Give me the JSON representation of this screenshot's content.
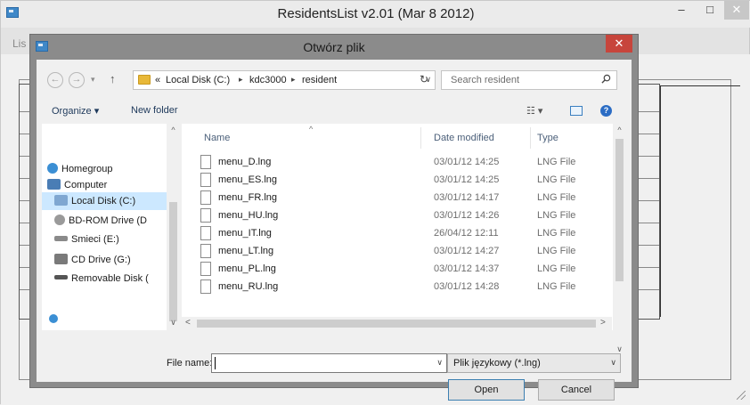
{
  "main_window": {
    "title": "ResidentsList v2.01  (Mar  8 2012)",
    "minimize_glyph": "–",
    "maximize_glyph": "□",
    "close_glyph": "✕",
    "menu_stub": "Lis"
  },
  "dialog": {
    "title": "Otwórz plik",
    "close_glyph": "✕",
    "nav": {
      "back_glyph": "←",
      "forward_glyph": "→",
      "recent_glyph": "▾",
      "up_glyph": "↑"
    },
    "address": {
      "overflow": "«",
      "crumbs": [
        "Local Disk (C:)",
        "kdc3000",
        "resident"
      ],
      "separator": "▸",
      "dropdown_glyph": "∨",
      "refresh_glyph": "↻"
    },
    "search": {
      "placeholder": "Search resident"
    },
    "toolbar": {
      "organize": "Organize ▾",
      "new_folder": "New folder",
      "view_glyph": "☷ ▾",
      "help_glyph": "?"
    },
    "nav_pane": {
      "items": [
        {
          "label": "Homegroup",
          "color": "#3b8fd4"
        },
        {
          "label": "Computer",
          "color": "#4a7db5"
        },
        {
          "label": "Local Disk (C:)",
          "color": "#7fa7d1"
        },
        {
          "label": "BD-ROM Drive (D",
          "color": "#9a9a9a"
        },
        {
          "label": "Smieci (E:)",
          "color": "#8a8a8a"
        },
        {
          "label": "CD Drive (G:)",
          "color": "#7a7a7a"
        },
        {
          "label": "Removable Disk (",
          "color": "#555555"
        }
      ],
      "selected": "Local Disk (C:)"
    },
    "file_list": {
      "columns": [
        "Name",
        "Date modified",
        "Type"
      ],
      "sort_glyph": "^",
      "rows": [
        {
          "name": "menu_D.lng",
          "date": "03/01/12 14:25",
          "type": "LNG File"
        },
        {
          "name": "menu_ES.lng",
          "date": "03/01/12 14:25",
          "type": "LNG File"
        },
        {
          "name": "menu_FR.lng",
          "date": "03/01/12 14:17",
          "type": "LNG File"
        },
        {
          "name": "menu_HU.lng",
          "date": "03/01/12 14:26",
          "type": "LNG File"
        },
        {
          "name": "menu_IT.lng",
          "date": "26/04/12 12:11",
          "type": "LNG File"
        },
        {
          "name": "menu_LT.lng",
          "date": "03/01/12 14:27",
          "type": "LNG File"
        },
        {
          "name": "menu_PL.lng",
          "date": "03/01/12 14:37",
          "type": "LNG File"
        },
        {
          "name": "menu_RU.lng",
          "date": "03/01/12 14:28",
          "type": "LNG File"
        }
      ]
    },
    "filename": {
      "label": "File name:",
      "value": "",
      "dropdown_glyph": "∨"
    },
    "filetype": {
      "value": "Plik językowy (*.lng)",
      "dropdown_glyph": "∨"
    },
    "buttons": {
      "open": "Open",
      "cancel": "Cancel"
    },
    "scroll": {
      "up": "^",
      "down": "∨",
      "left": "<",
      "right": ">"
    }
  }
}
